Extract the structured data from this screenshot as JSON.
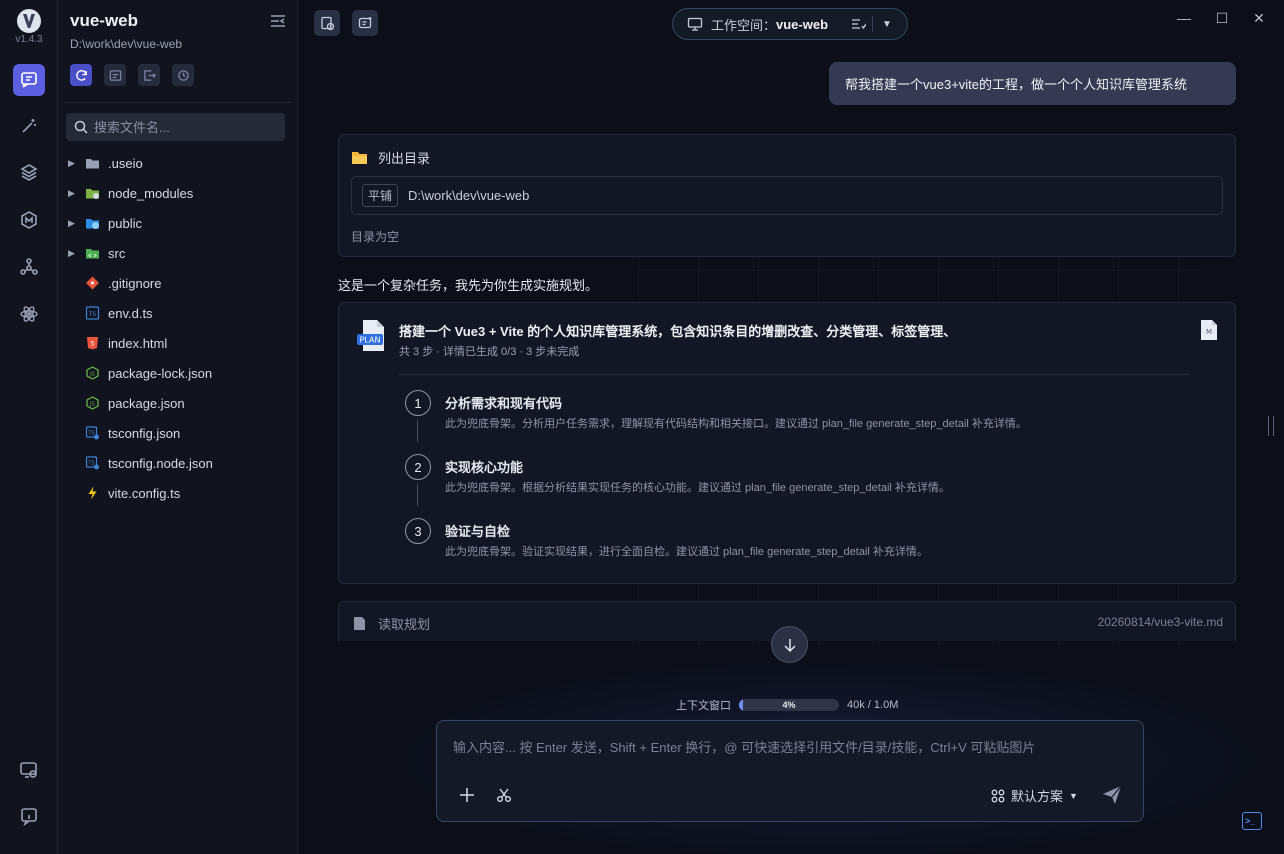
{
  "app": {
    "version": "v1.4.3"
  },
  "sidebar": {
    "project_title": "vue-web",
    "project_path": "D:\\work\\dev\\vue-web",
    "search_placeholder": "搜索文件名...",
    "files": [
      {
        "name": ".useio",
        "type": "folder",
        "icon": "folder-icon"
      },
      {
        "name": "node_modules",
        "type": "folder",
        "icon": "node-folder-icon"
      },
      {
        "name": "public",
        "type": "folder",
        "icon": "public-folder-icon"
      },
      {
        "name": "src",
        "type": "folder",
        "icon": "src-folder-icon"
      },
      {
        "name": ".gitignore",
        "type": "file",
        "icon": "git-icon"
      },
      {
        "name": "env.d.ts",
        "type": "file",
        "icon": "typescript-icon"
      },
      {
        "name": "index.html",
        "type": "file",
        "icon": "html-icon"
      },
      {
        "name": "package-lock.json",
        "type": "file",
        "icon": "json-icon"
      },
      {
        "name": "package.json",
        "type": "file",
        "icon": "json-icon"
      },
      {
        "name": "tsconfig.json",
        "type": "file",
        "icon": "tsconfig-icon"
      },
      {
        "name": "tsconfig.node.json",
        "type": "file",
        "icon": "tsconfig-icon"
      },
      {
        "name": "vite.config.ts",
        "type": "file",
        "icon": "vite-icon"
      }
    ]
  },
  "header": {
    "workspace_label": "工作空间：",
    "workspace_name": "vue-web"
  },
  "chat": {
    "user_message": "帮我搭建一个vue3+vite的工程，做一个个人知识库管理系统",
    "list_dir": {
      "title": "列出目录",
      "tag": "平铺",
      "path": "D:\\work\\dev\\vue-web",
      "result": "目录为空"
    },
    "assistant_text": "这是一个复杂任务，我先为你生成实施规划。",
    "plan": {
      "title": "搭建一个 Vue3 + Vite 的个人知识库管理系统，包含知识条目的增删改查、分类管理、标签管理、",
      "subtitle": "共 3 步 · 详情已生成 0/3 · 3 步未完成",
      "steps": [
        {
          "num": "1",
          "title": "分析需求和现有代码",
          "desc": "此为兜底骨架。分析用户任务需求，理解现有代码结构和相关接口。建议通过 plan_file generate_step_detail 补充详情。"
        },
        {
          "num": "2",
          "title": "实现核心功能",
          "desc": "此为兜底骨架。根据分析结果实现任务的核心功能。建议通过 plan_file generate_step_detail 补充详情。"
        },
        {
          "num": "3",
          "title": "验证与自检",
          "desc": "此为兜底骨架。验证实现结果，进行全面自检。建议通过 plan_file generate_step_detail 补充详情。"
        }
      ]
    },
    "read_plan": {
      "title": "读取规划",
      "file": "20260814/vue3-vite.md"
    }
  },
  "context": {
    "label": "上下文窗口",
    "percent": "4%",
    "fill_fraction": 0.04,
    "usage": "40k / 1.0M"
  },
  "composer": {
    "placeholder": "输入内容... 按 Enter 发送，Shift + Enter 换行，@ 可快速选择引用文件/目录/技能，Ctrl+V 可粘贴图片",
    "scheme_label": "默认方案"
  },
  "colors": {
    "accent": "#5b5fe0",
    "user_bubble": "#353a52",
    "folder": "#f2b63a",
    "terminal": "#4a8cf0"
  }
}
